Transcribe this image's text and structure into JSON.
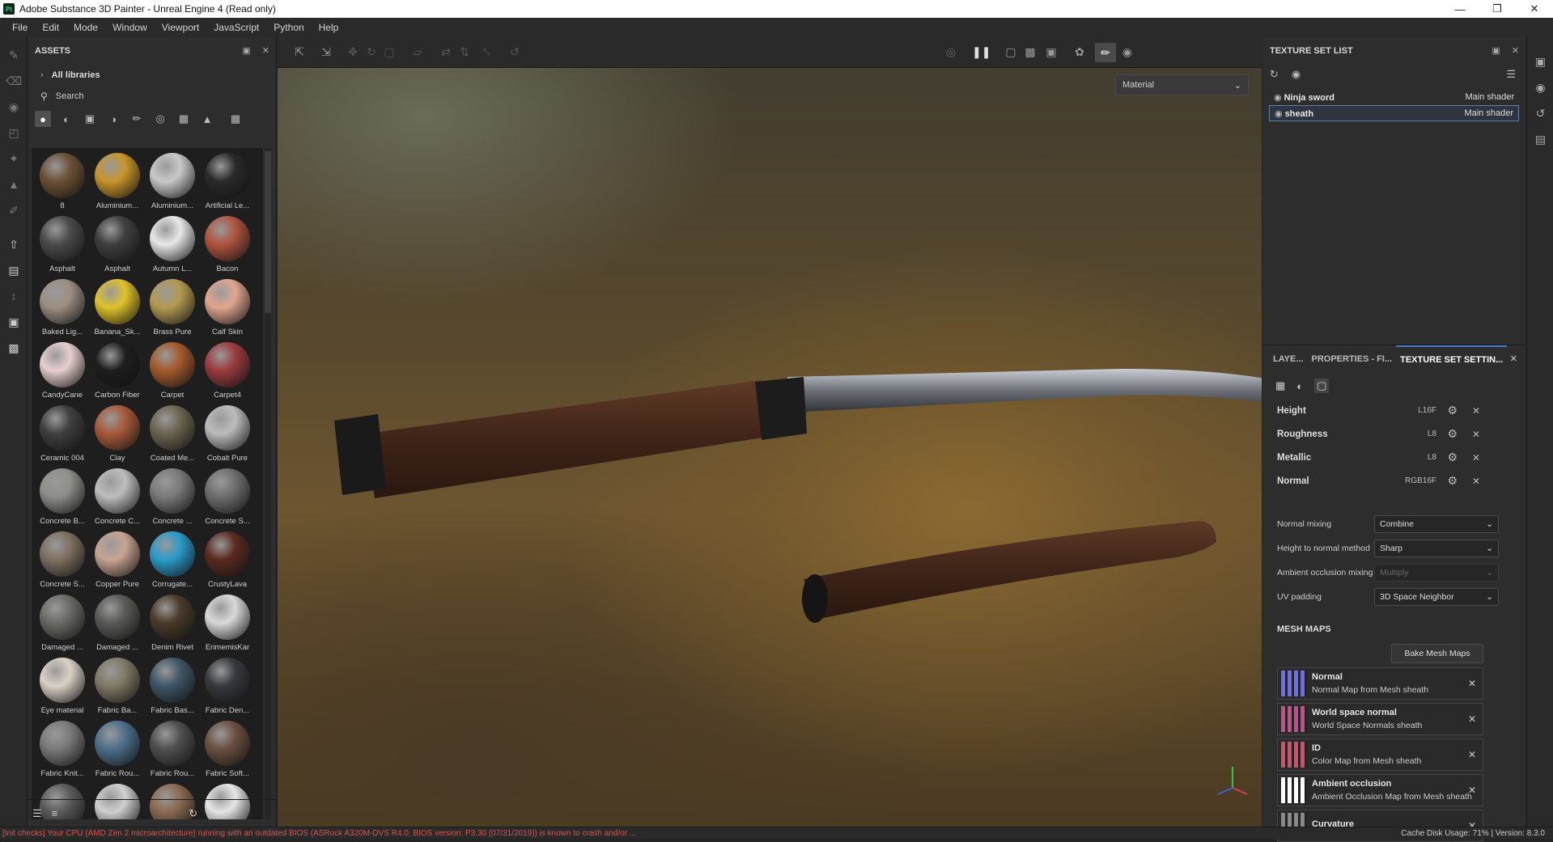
{
  "window": {
    "title": "Adobe Substance 3D Painter - Unreal Engine 4 (Read only)",
    "app_icon": "Pt"
  },
  "menu": [
    "File",
    "Edit",
    "Mode",
    "Window",
    "Viewport",
    "JavaScript",
    "Python",
    "Help"
  ],
  "assets": {
    "title": "ASSETS",
    "library": "All libraries",
    "search_placeholder": "Search",
    "tiles": [
      {
        "label": "8",
        "color": "#6b5136"
      },
      {
        "label": "Aluminium...",
        "color": "#c9952a"
      },
      {
        "label": "Aluminium...",
        "color": "#c9c9c9"
      },
      {
        "label": "Artificial Le...",
        "color": "#2a2a2a"
      },
      {
        "label": "Asphalt",
        "color": "#4a4a4a"
      },
      {
        "label": "Asphalt",
        "color": "#3f3f3f"
      },
      {
        "label": "Autumn L...",
        "color": "#e8e8e8"
      },
      {
        "label": "Bacon",
        "color": "#b0543f"
      },
      {
        "label": "Baked Lig...",
        "color": "#9c8f82"
      },
      {
        "label": "Banana_Sk...",
        "color": "#e0c22a"
      },
      {
        "label": "Brass Pure",
        "color": "#b39a52"
      },
      {
        "label": "Calf Skin",
        "color": "#e0a690"
      },
      {
        "label": "CandyCane",
        "color": "#e6cfcf"
      },
      {
        "label": "Carbon Fiber",
        "color": "#1e1e1e"
      },
      {
        "label": "Carpet",
        "color": "#a35a2c"
      },
      {
        "label": "Carpet4",
        "color": "#9b3b3f"
      },
      {
        "label": "Ceramic 004",
        "color": "#3f3f3f"
      },
      {
        "label": "Clay",
        "color": "#a85a3a"
      },
      {
        "label": "Coated Me...",
        "color": "#6a6450"
      },
      {
        "label": "Cobalt Pure",
        "color": "#bcbcbc"
      },
      {
        "label": "Concrete B...",
        "color": "#8e8e8a"
      },
      {
        "label": "Concrete C...",
        "color": "#bdbdbd"
      },
      {
        "label": "Concrete ...",
        "color": "#7a7a7a"
      },
      {
        "label": "Concrete S...",
        "color": "#6e6e6e"
      },
      {
        "label": "Concrete S...",
        "color": "#7d7060"
      },
      {
        "label": "Copper Pure",
        "color": "#c7a392"
      },
      {
        "label": "Corrugate...",
        "color": "#2a9bc9"
      },
      {
        "label": "CrustyLava",
        "color": "#5a2a20"
      },
      {
        "label": "Damaged ...",
        "color": "#6a6a66"
      },
      {
        "label": "Damaged ...",
        "color": "#5a5a58"
      },
      {
        "label": "Denim Rivet",
        "color": "#4a3a2a"
      },
      {
        "label": "ErimemisKar",
        "color": "#d9d9d9"
      },
      {
        "label": "Eye material",
        "color": "#d9d2c8"
      },
      {
        "label": "Fabric Ba...",
        "color": "#7f7a66"
      },
      {
        "label": "Fabric Bas...",
        "color": "#3f5566"
      },
      {
        "label": "Fabric Den...",
        "color": "#36393d"
      },
      {
        "label": "Fabric Knit...",
        "color": "#7a7a7a"
      },
      {
        "label": "Fabric Rou...",
        "color": "#4d6f8a"
      },
      {
        "label": "Fabric Rou...",
        "color": "#4f4f4f"
      },
      {
        "label": "Fabric Soft...",
        "color": "#6a5040"
      },
      {
        "label": "",
        "color": "#5a5a5a"
      },
      {
        "label": "",
        "color": "#cfcfcf"
      },
      {
        "label": "",
        "color": "#8a6a50"
      },
      {
        "label": "",
        "color": "#e6e6e6"
      }
    ]
  },
  "viewport": {
    "channel_select": "Material"
  },
  "texture_set_list": {
    "title": "TEXTURE SET LIST",
    "sets": [
      {
        "name": "Ninja sword",
        "shader": "Main shader"
      },
      {
        "name": "sheath",
        "shader": "Main shader"
      }
    ]
  },
  "tss": {
    "tabs": [
      "LAYE...",
      "PROPERTIES - FI...",
      "TEXTURE SET SETTIN..."
    ],
    "channels": [
      {
        "name": "Height",
        "format": "L16F"
      },
      {
        "name": "Roughness",
        "format": "L8"
      },
      {
        "name": "Metallic",
        "format": "L8"
      },
      {
        "name": "Normal",
        "format": "RGB16F"
      }
    ],
    "props": [
      {
        "label": "Normal mixing",
        "value": "Combine"
      },
      {
        "label": "Height to normal method",
        "value": "Sharp"
      },
      {
        "label": "Ambient occlusion mixing",
        "value": "Multiply"
      },
      {
        "label": "UV padding",
        "value": "3D Space Neighbor"
      }
    ],
    "mesh_maps_title": "MESH MAPS",
    "bake_label": "Bake Mesh Maps",
    "mesh_maps": [
      {
        "title": "Normal",
        "sub": "Normal Map from Mesh sheath",
        "color": "#6c6cf0"
      },
      {
        "title": "World space normal",
        "sub": "World Space Normals sheath",
        "color": "#c0508a"
      },
      {
        "title": "ID",
        "sub": "Color Map from Mesh sheath",
        "color": "#d0506a"
      },
      {
        "title": "Ambient occlusion",
        "sub": "Ambient Occlusion Map from Mesh sheath",
        "color": "#ffffff"
      },
      {
        "title": "Curvature",
        "sub": "",
        "color": "#888888"
      }
    ]
  },
  "status": {
    "message": "[Init checks] Your CPU (AMD Zen 2 microarchitecture) running with an outdated BIOS (ASRock A320M-DVS R4.0, BIOS version: P3.30 (07/31/2019)) is known to crash and/or ...",
    "right": "Cache Disk Usage:   71% | Version: 8.3.0"
  }
}
